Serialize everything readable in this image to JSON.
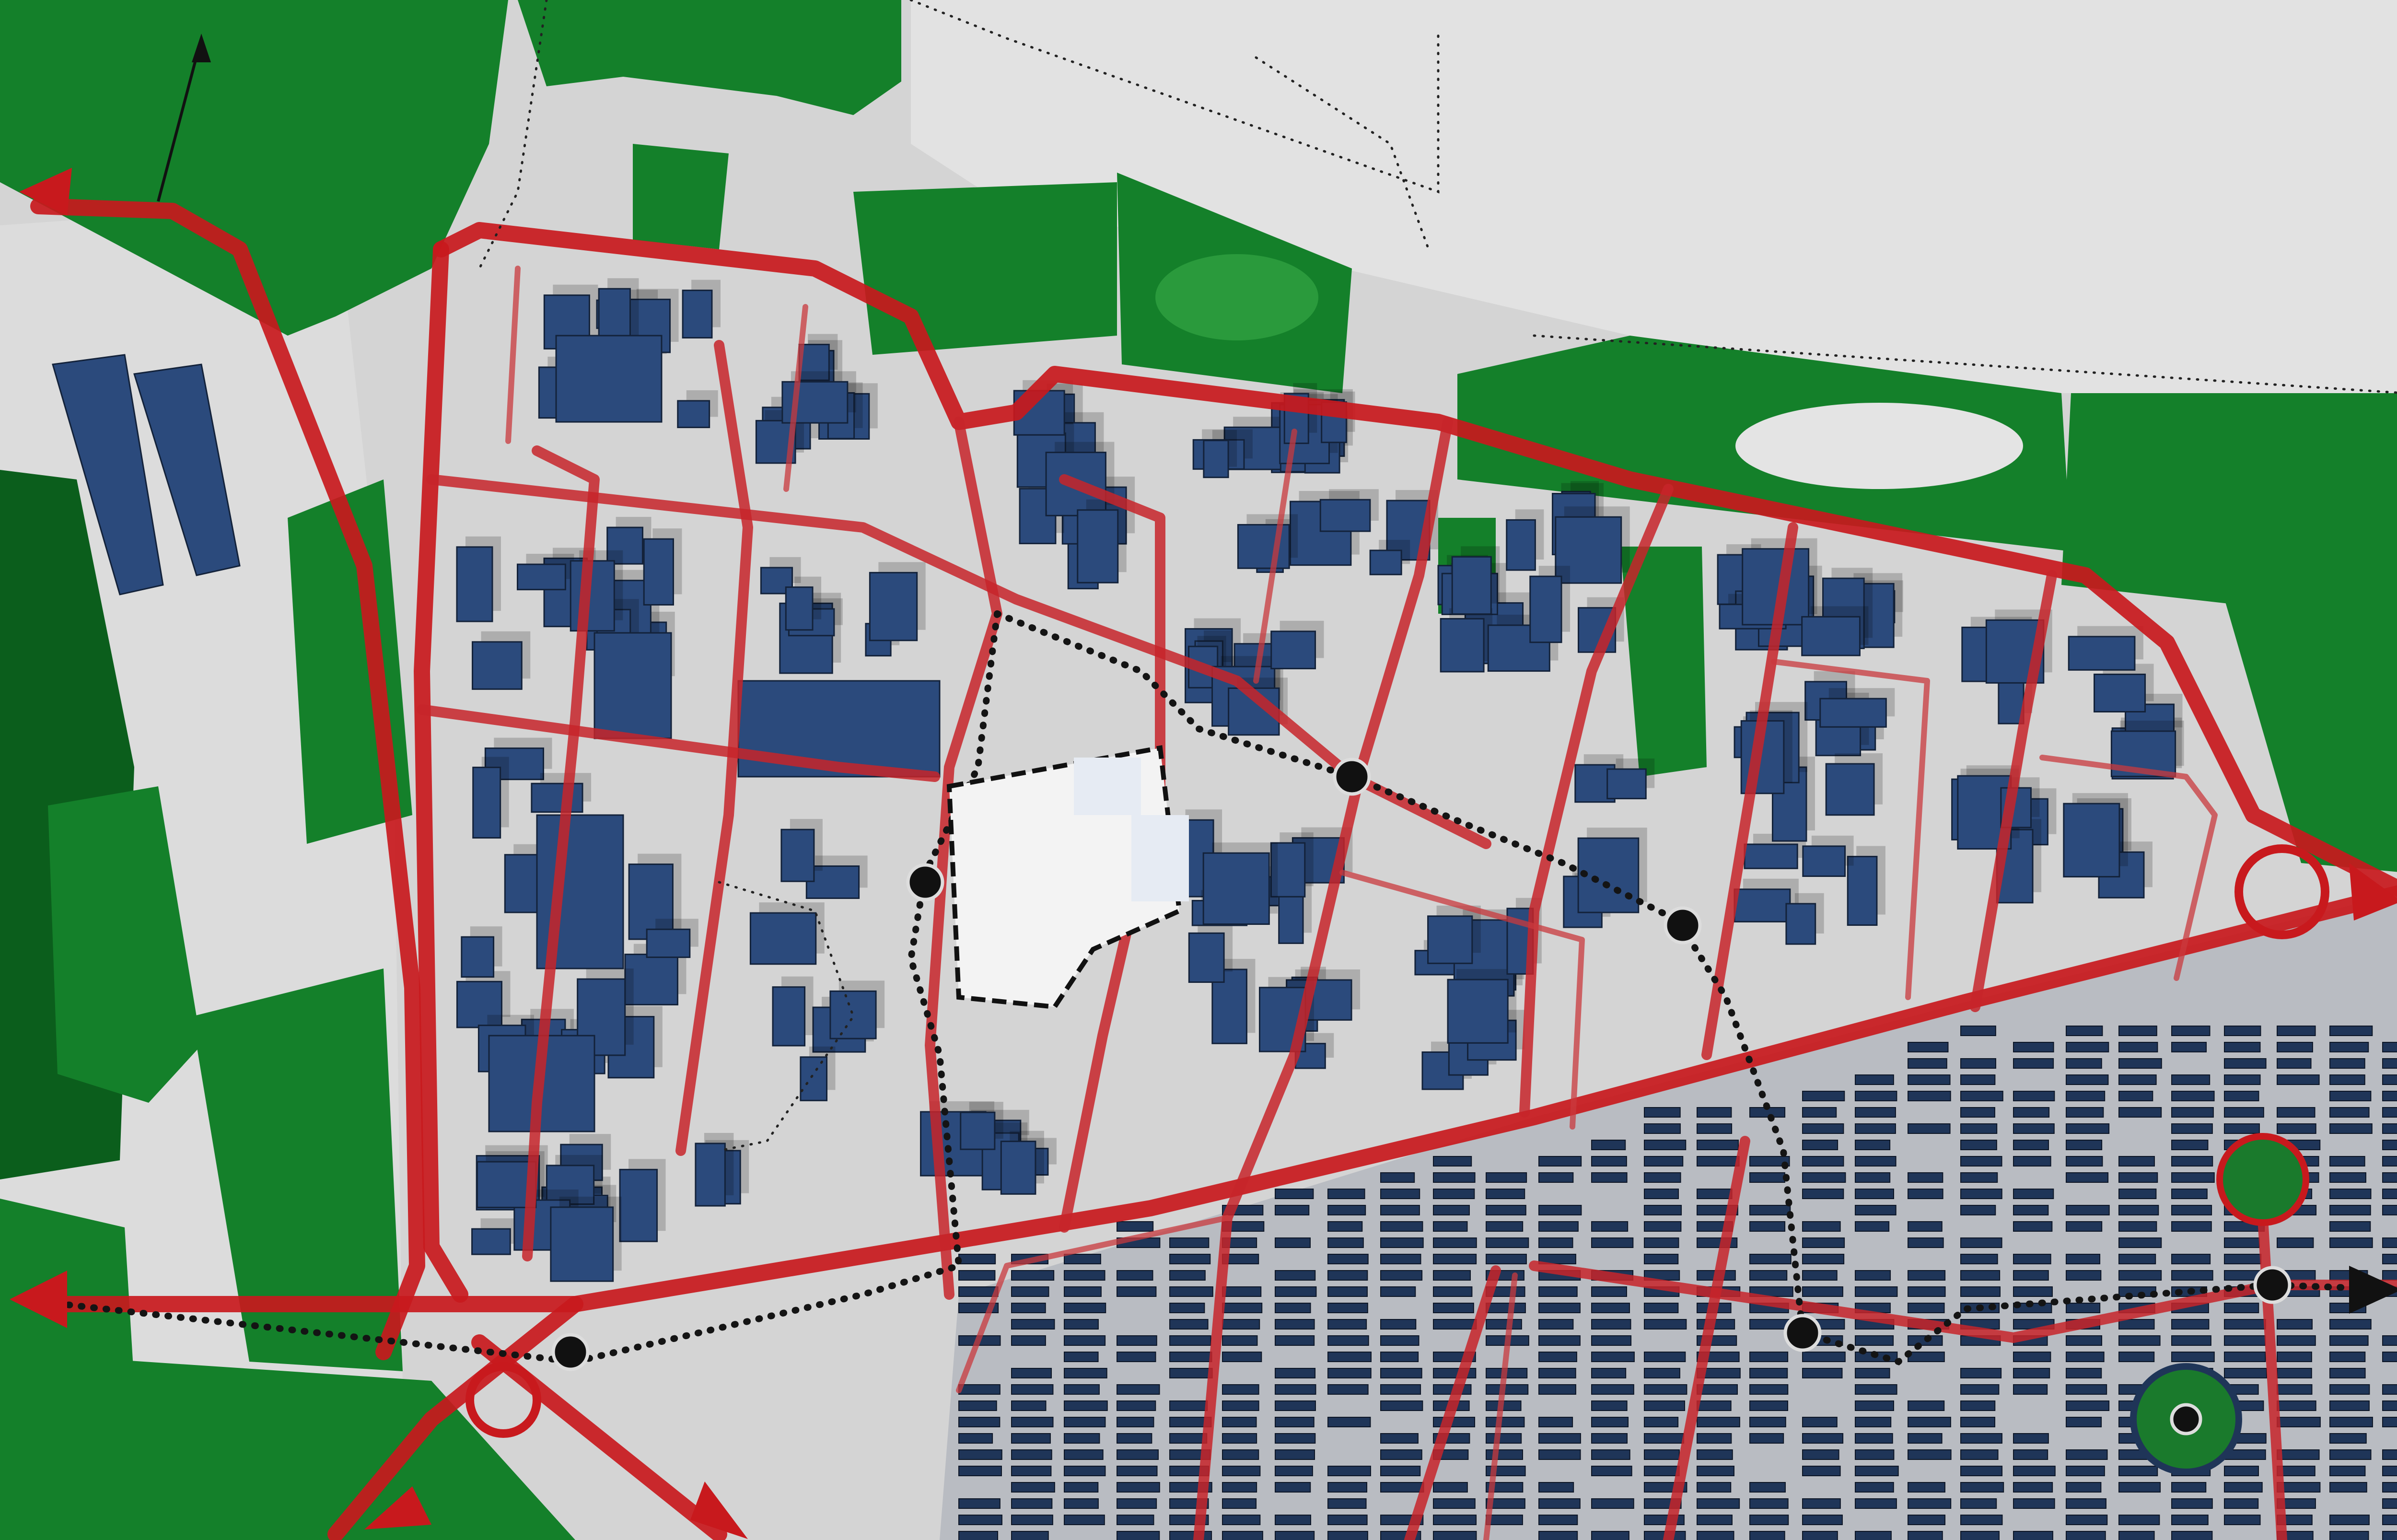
{
  "map": {
    "type": "urban-masterplan-aerial",
    "legend": [],
    "labels": [],
    "colors": {
      "primary_road": "#c8191d",
      "secondary_road": "#c7242a",
      "building": "#2b4a7c",
      "green_space": "#14802a",
      "open_ground": "#d9d9d9",
      "rail_line": "#141414"
    },
    "stop_count": 7,
    "icons": [
      "arrow-head-icon",
      "transit-stop-icon",
      "north-arrow-icon"
    ]
  }
}
